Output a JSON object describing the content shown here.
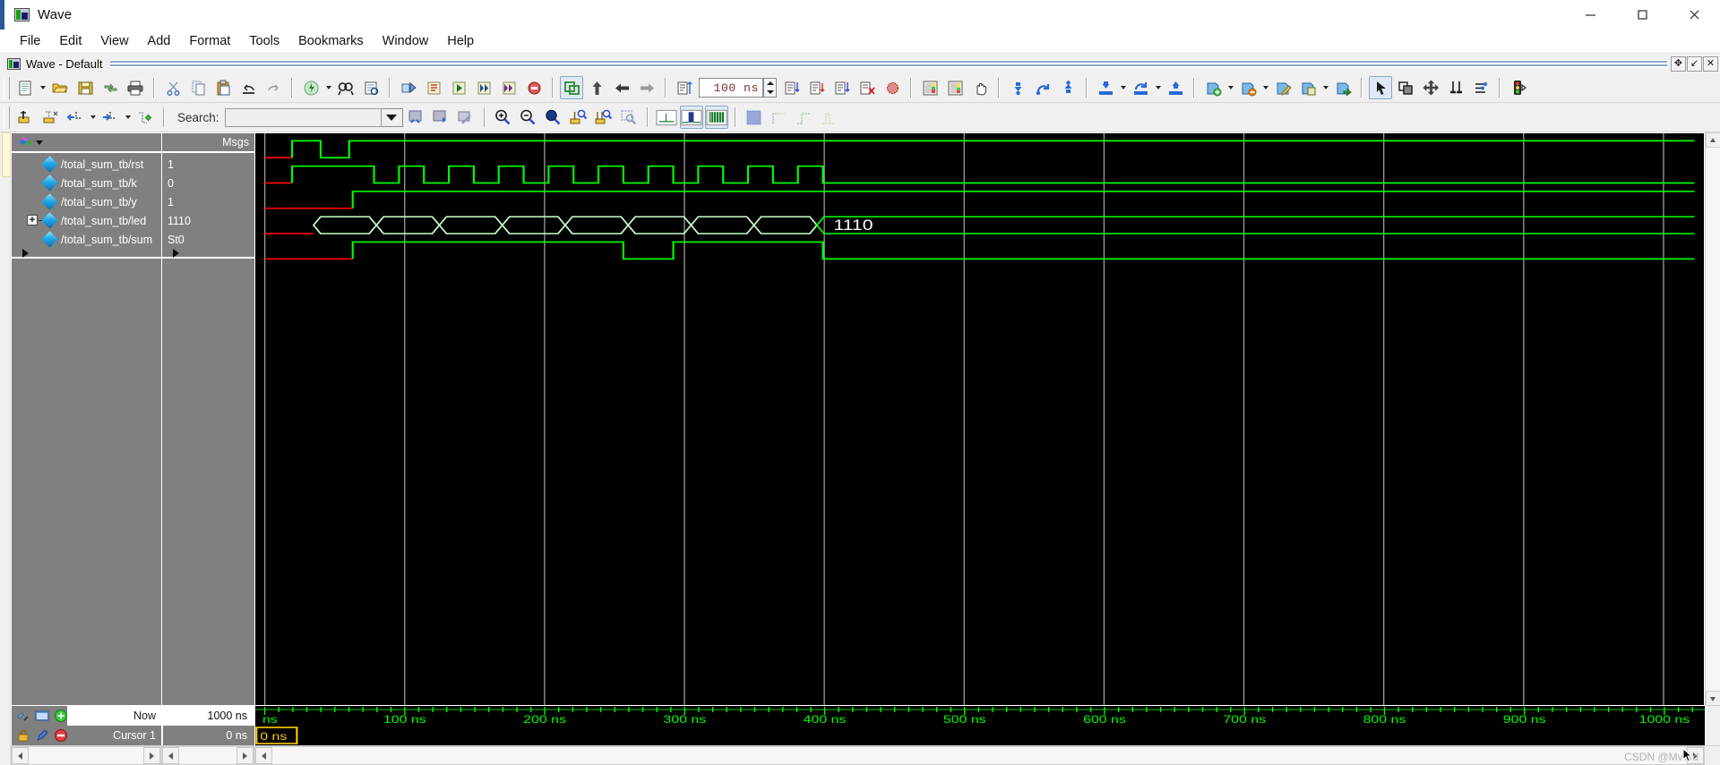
{
  "window": {
    "title": "Wave",
    "icon": "wave-window-icon",
    "minimize_label": "—",
    "maximize_label": "□",
    "close_label": "✕"
  },
  "menubar": {
    "items": [
      {
        "label": "File"
      },
      {
        "label": "Edit"
      },
      {
        "label": "View"
      },
      {
        "label": "Add"
      },
      {
        "label": "Format"
      },
      {
        "label": "Tools"
      },
      {
        "label": "Bookmarks"
      },
      {
        "label": "Window"
      },
      {
        "label": "Help"
      }
    ]
  },
  "mdi": {
    "title": "Wave - Default",
    "buttons": [
      {
        "name": "restore-down-button",
        "label": "✥"
      },
      {
        "name": "undock-button",
        "label": "↙"
      },
      {
        "name": "close-pane-button",
        "label": "✕"
      }
    ]
  },
  "toolbar_main": {
    "groups": [
      {
        "name": "file-group",
        "buttons": [
          "new-file-icon",
          "open-file-icon",
          "save-icon",
          "reload-icon",
          "print-icon"
        ]
      },
      {
        "name": "edit-group",
        "buttons": [
          "cut-icon",
          "copy-icon",
          "paste-icon",
          "undo-icon",
          "redo-icon"
        ]
      },
      {
        "name": "compile-group",
        "buttons": [
          "compile-icon",
          "find-icon",
          "find-in-files-icon"
        ]
      },
      {
        "name": "sim-group",
        "buttons": [
          "simulate-icon",
          "restart-icon",
          "run-icon",
          "continue-run-icon",
          "run-all-icon",
          "break-icon"
        ]
      },
      {
        "name": "step-group",
        "buttons": [
          "step-into-icon",
          "step-over-icon",
          "step-out-icon"
        ]
      }
    ],
    "run_time_value": "100 ns",
    "spinner": {
      "up": "▲",
      "down": "▼"
    }
  },
  "toolbar_wave": {
    "search_label": "Search:",
    "search_value": "",
    "search_placeholder": "",
    "buttons": [
      "insert-cursor-icon",
      "delete-cursor-icon",
      "find-previous-transition-icon",
      "find-next-transition-icon",
      "find-falling-edge-icon",
      "zoom-in-icon",
      "zoom-out-icon",
      "zoom-full-icon",
      "zoom-in-on-active-cursor-icon",
      "zoom-out-on-active-cursor-icon",
      "zoom-mode-icon",
      "wave-expand-time-icon",
      "wave-collapse-time-icon",
      "wave-collapse-all-icon",
      "expanded-time-off-icon",
      "expanded-time-delta-icon",
      "expanded-time-event-icon",
      "expanded-time-full-icon"
    ]
  },
  "wave_panel": {
    "name_header": "",
    "value_header": "Msgs",
    "signals": [
      {
        "path": "/total_sum_tb/rst",
        "value": "1",
        "expandable": false,
        "type": "wire"
      },
      {
        "path": "/total_sum_tb/k",
        "value": "0",
        "expandable": false,
        "type": "wire"
      },
      {
        "path": "/total_sum_tb/y",
        "value": "1",
        "expandable": false,
        "type": "wire"
      },
      {
        "path": "/total_sum_tb/led",
        "value": "1110",
        "expandable": true,
        "type": "bus"
      },
      {
        "path": "/total_sum_tb/sum",
        "value": "St0",
        "expandable": false,
        "type": "wire"
      }
    ],
    "bus_label": "1110"
  },
  "status": {
    "now_label": "Now",
    "now_value": "1000 ns",
    "cursor_label": "Cursor 1",
    "cursor_value": "0 ns",
    "cursor_marker": "0 ns"
  },
  "timeline": {
    "unit": "ns",
    "start": 0,
    "end": 1040,
    "major_ticks": [
      {
        "value": 0,
        "label": "ns"
      },
      {
        "value": 100,
        "label": "100 ns"
      },
      {
        "value": 200,
        "label": "200 ns"
      },
      {
        "value": 300,
        "label": "300 ns"
      },
      {
        "value": 400,
        "label": "400 ns"
      },
      {
        "value": 500,
        "label": "500 ns"
      },
      {
        "value": 600,
        "label": "600 ns"
      },
      {
        "value": 700,
        "label": "700 ns"
      },
      {
        "value": 800,
        "label": "800 ns"
      },
      {
        "value": 900,
        "label": "900 ns"
      },
      {
        "value": 1000,
        "label": "1000 ns"
      }
    ],
    "minor_tick_step": 10
  },
  "colors": {
    "signal_high": "#00ff00",
    "signal_undefined": "#ff0000",
    "bus_outline": "#c8ffc8",
    "wave_background": "#000000",
    "panel_background": "#808080",
    "timeline_text": "#00ff00",
    "cursor_marker": "#ffff00",
    "toolbar_background": "#f0f0f0"
  },
  "waveforms": {
    "rst": {
      "undef_until": 20,
      "edges": [
        [
          20,
          1
        ],
        [
          38,
          0
        ],
        [
          54,
          1
        ]
      ]
    },
    "k": {
      "undef_until": 20,
      "edges": [
        [
          20,
          1
        ],
        [
          56,
          0
        ],
        [
          72,
          1
        ],
        [
          84,
          0
        ],
        [
          96,
          1
        ],
        [
          108,
          0
        ],
        [
          120,
          1
        ],
        [
          132,
          0
        ],
        [
          144,
          1
        ],
        [
          160,
          0
        ],
        [
          176,
          1
        ],
        [
          188,
          0
        ],
        [
          200,
          1
        ],
        [
          212,
          0
        ],
        [
          224,
          1
        ],
        [
          236,
          0
        ],
        [
          252,
          1
        ],
        [
          268,
          0
        ],
        [
          280,
          1
        ],
        [
          292,
          0
        ]
      ]
    },
    "y": {
      "undef_until": 45,
      "edges": [
        [
          45,
          1
        ]
      ]
    },
    "sum": {
      "undef_until": 45,
      "edges": [
        [
          45,
          1
        ],
        [
          160,
          0
        ],
        [
          190,
          1
        ],
        [
          292,
          0
        ]
      ]
    },
    "led_transitions": [
      32,
      60,
      88,
      116,
      144,
      172,
      200,
      228,
      256,
      284
    ]
  },
  "watermark": "CSDN @Mvord"
}
